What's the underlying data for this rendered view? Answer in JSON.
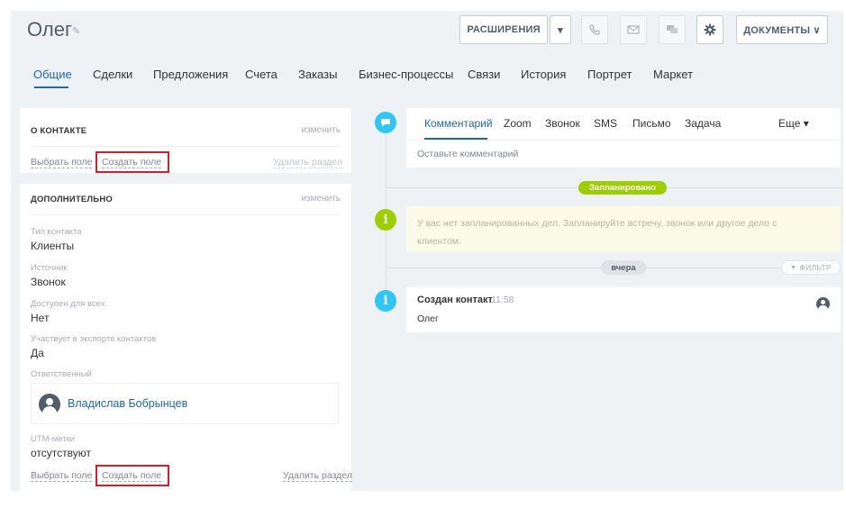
{
  "header": {
    "title": "Олег",
    "edit_icon": "✎",
    "extensions_label": "РАСШИРЕНИЯ",
    "extensions_arrow": "▾",
    "documents_label": "ДОКУМЕНТЫ ∨"
  },
  "tabs": [
    {
      "label": "Общие"
    },
    {
      "label": "Сделки"
    },
    {
      "label": "Предложения"
    },
    {
      "label": "Счета"
    },
    {
      "label": "Заказы"
    },
    {
      "label": "Бизнес-процессы"
    },
    {
      "label": "Связи"
    },
    {
      "label": "История"
    },
    {
      "label": "Портрет"
    },
    {
      "label": "Маркет"
    }
  ],
  "contact_panel": {
    "title": "О КОНТАКТЕ",
    "edit": "изменить",
    "select_field": "Выбрать поле",
    "create_field": "Создать поле",
    "delete_section": "Удалить раздел"
  },
  "additional_panel": {
    "title": "ДОПОЛНИТЕЛЬНО",
    "edit": "изменить",
    "fields": [
      {
        "label": "Тип контакта",
        "value": "Клиенты"
      },
      {
        "label": "Источник",
        "value": "Звонок"
      },
      {
        "label": "Доступен для всех",
        "value": "Нет"
      },
      {
        "label": "Участвует в экспорте контактов",
        "value": "Да"
      }
    ],
    "responsible_label": "Ответственный",
    "responsible_name": "Владислав Бобрынцев",
    "utm_label": "UTM-метки",
    "utm_value": "отсутствуют",
    "select_field": "Выбрать поле",
    "create_field": "Создать поле",
    "delete_section": "Удалить раздел"
  },
  "editor": {
    "tabs": [
      {
        "label": "Комментарий"
      },
      {
        "label": "Zoom"
      },
      {
        "label": "Звонок"
      },
      {
        "label": "SMS"
      },
      {
        "label": "Письмо"
      },
      {
        "label": "Задача"
      },
      {
        "label": "Еще ▾"
      }
    ],
    "placeholder": "Оставьте комментарий"
  },
  "timeline": {
    "planned_badge": "Запланировано",
    "planned_text": "У вас нет запланированных дел. Запланируйте встречу, звонок или другое дело с клиентом.",
    "yesterday_badge": "вчера",
    "filter_label": "ФИЛЬТР",
    "filter_icon": "▼",
    "created_title": "Создан контакт",
    "created_time": "11:58",
    "created_name": "Олег",
    "info_glyph": "i"
  },
  "colors": {
    "accent": "#2067b0",
    "planned": "#9dcf00",
    "info": "#2fc6f6",
    "highlight": "#d2202f"
  }
}
